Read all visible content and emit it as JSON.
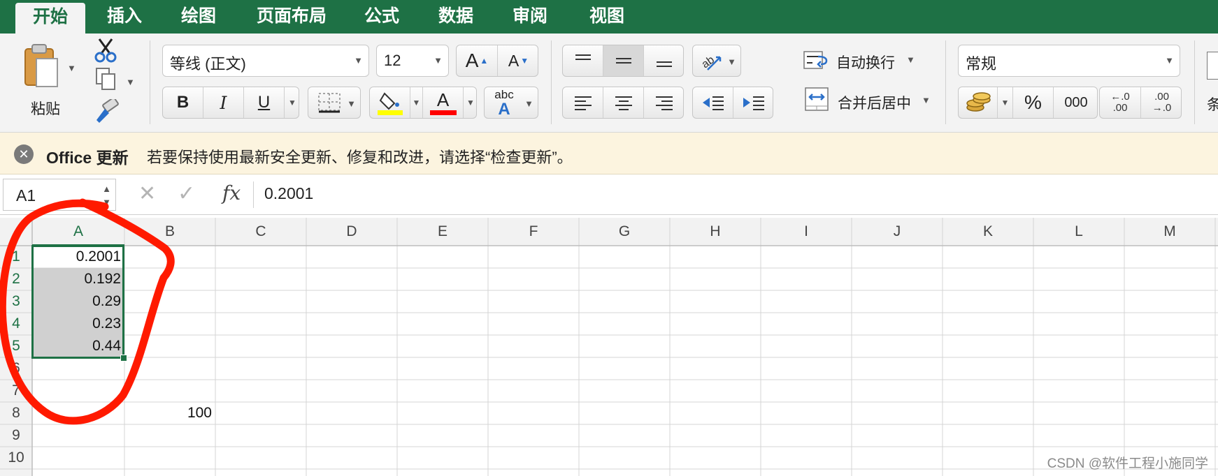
{
  "ribbon": {
    "tabs": [
      {
        "label": "开始",
        "active": true
      },
      {
        "label": "插入"
      },
      {
        "label": "绘图"
      },
      {
        "label": "页面布局"
      },
      {
        "label": "公式"
      },
      {
        "label": "数据"
      },
      {
        "label": "审阅"
      },
      {
        "label": "视图"
      }
    ],
    "clipboard": {
      "paste_label": "粘贴"
    },
    "font": {
      "name": "等线 (正文)",
      "size": "12",
      "grow_glyph": "A",
      "shrink_glyph": "A",
      "bold_glyph": "B",
      "italic_glyph": "I",
      "underline_glyph": "U",
      "font_color_glyph": "A",
      "phonetic_glyph": "abc",
      "phonetic_sub": "A",
      "highlight_color": "#ffff00",
      "font_color": "#ff0000"
    },
    "alignment": {
      "wrap_text": "自动换行",
      "merge_center": "合并后居中"
    },
    "number": {
      "format": "常规",
      "percent": "%",
      "comma": "000",
      "inc_decimal_top": "←.0",
      "inc_decimal_bottom": ".00",
      "dec_decimal_top": ".00",
      "dec_decimal_bottom": "→.0"
    },
    "styles": {
      "partial_label": "条"
    }
  },
  "update_bar": {
    "title": "Office 更新",
    "message": "若要保持使用最新安全更新、修复和改进，请选择“检查更新”。"
  },
  "formula_bar": {
    "name_box": "A1",
    "fx_label": "fx",
    "value": "0.2001"
  },
  "grid": {
    "columns": [
      "A",
      "B",
      "C",
      "D",
      "E",
      "F",
      "G",
      "H",
      "I",
      "J",
      "K",
      "L",
      "M"
    ],
    "rows": [
      "1",
      "2",
      "3",
      "4",
      "5",
      "6",
      "7",
      "8",
      "9",
      "10"
    ],
    "cells": {
      "A1": "0.2001",
      "A2": "0.192",
      "A3": "0.29",
      "A4": "0.23",
      "A5": "0.44",
      "B8": "100"
    },
    "selection": "A1:A5",
    "annotation_color": "#ff1a00"
  },
  "watermark": "CSDN @软件工程小施同学",
  "colors": {
    "brand_green": "#1e7145",
    "ribbon_bg": "#f3f3f3",
    "update_bg": "#fcf4df",
    "selection_fill": "#d0d0d0"
  }
}
